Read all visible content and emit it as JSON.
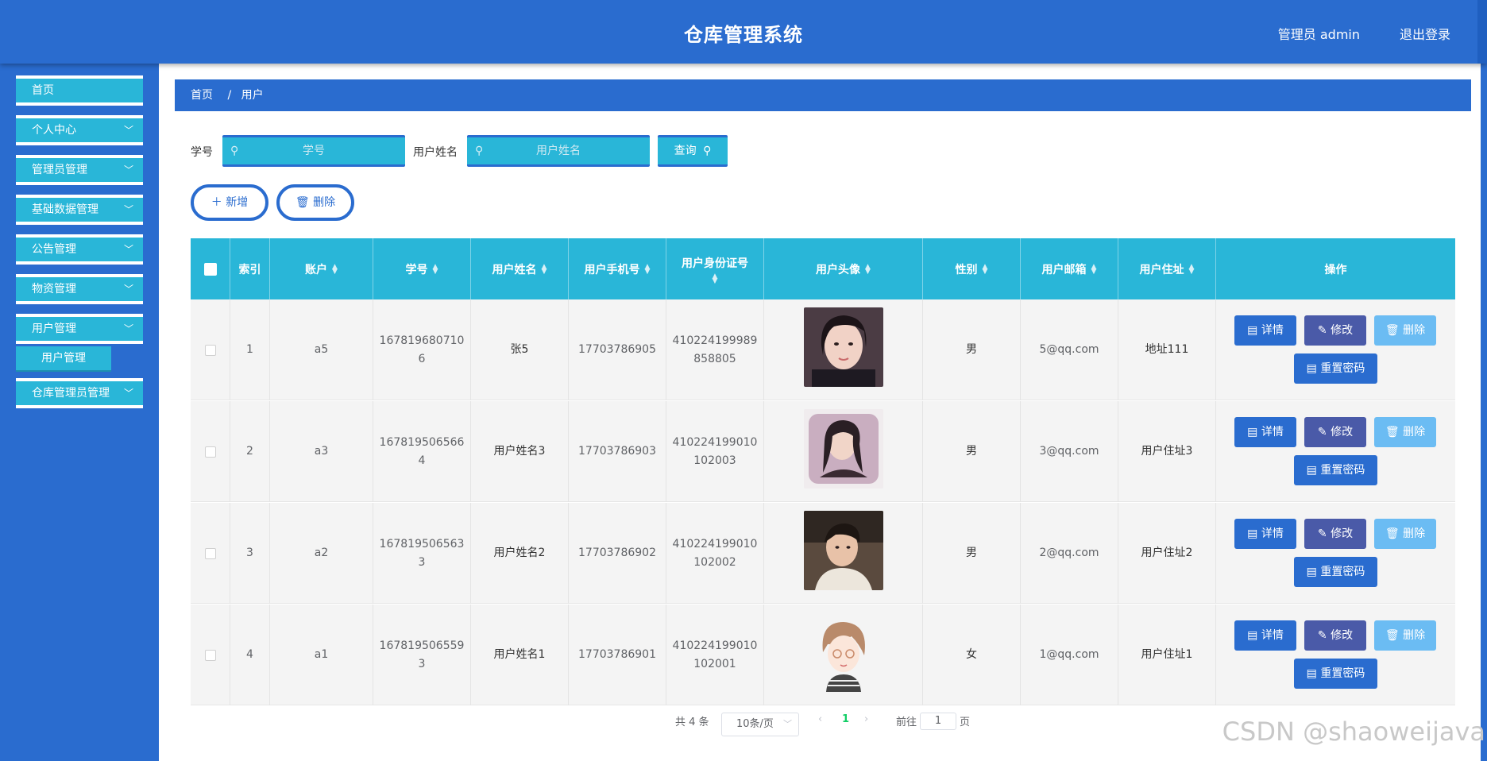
{
  "header": {
    "title": "仓库管理系统",
    "user": "管理员 admin",
    "logout": "退出登录"
  },
  "sidebar": {
    "items": [
      {
        "label": "首页",
        "chevron": false
      },
      {
        "label": "个人中心",
        "chevron": true
      },
      {
        "label": "管理员管理",
        "chevron": true
      },
      {
        "label": "基础数据管理",
        "chevron": true
      },
      {
        "label": "公告管理",
        "chevron": true
      },
      {
        "label": "物资管理",
        "chevron": true
      },
      {
        "label": "用户管理",
        "chevron": true
      },
      {
        "label": "仓库管理员管理",
        "chevron": true
      }
    ],
    "sub_item": "用户管理"
  },
  "breadcrumb": {
    "home": "首页",
    "sep": "/",
    "current": "用户"
  },
  "search": {
    "student_id_label": "学号",
    "student_id_placeholder": "学号",
    "name_label": "用户姓名",
    "name_placeholder": "用户姓名",
    "query_button": "查询"
  },
  "actions": {
    "add": "新增",
    "delete": "删除"
  },
  "table": {
    "columns": [
      "索引",
      "账户",
      "学号",
      "用户姓名",
      "用户手机号",
      "用户身份证号",
      "用户头像",
      "性别",
      "用户邮箱",
      "用户住址",
      "操作"
    ],
    "rows": [
      {
        "index": "1",
        "account": "a5",
        "student_id_1": "167819680710",
        "student_id_2": "6",
        "name": "张5",
        "phone": "17703786905",
        "idcard_1": "410224199989",
        "idcard_2": "858805",
        "avatar": "female-portrait",
        "gender": "男",
        "email": "5@qq.com",
        "address": "地址111"
      },
      {
        "index": "2",
        "account": "a3",
        "student_id_1": "167819506566",
        "student_id_2": "4",
        "name": "用户姓名3",
        "phone": "17703786903",
        "idcard_1": "410224199010",
        "idcard_2": "102003",
        "avatar": "pillow-portrait",
        "gender": "男",
        "email": "3@qq.com",
        "address": "用户住址3"
      },
      {
        "index": "3",
        "account": "a2",
        "student_id_1": "167819506563",
        "student_id_2": "3",
        "name": "用户姓名2",
        "phone": "17703786902",
        "idcard_1": "410224199010",
        "idcard_2": "102002",
        "avatar": "male-portrait",
        "gender": "男",
        "email": "2@qq.com",
        "address": "用户住址2"
      },
      {
        "index": "4",
        "account": "a1",
        "student_id_1": "167819506559",
        "student_id_2": "3",
        "name": "用户姓名1",
        "phone": "17703786901",
        "idcard_1": "410224199010",
        "idcard_2": "102001",
        "avatar": "cartoon-girl",
        "gender": "女",
        "email": "1@qq.com",
        "address": "用户住址1"
      }
    ],
    "ops": {
      "detail": "详情",
      "edit": "修改",
      "delete": "删除",
      "reset": "重置密码"
    }
  },
  "pagination": {
    "total": "共 4 条",
    "page_size": "10条/页",
    "prev": "‹",
    "page": "1",
    "next": "›",
    "goto_label": "前往",
    "goto_value": "1",
    "page_unit": "页"
  },
  "watermark": "CSDN @shaoweijava",
  "colors": {
    "primary": "#2a6ccf",
    "accent": "#29b6d8",
    "edit": "#4a5aa8",
    "delete": "#6bbcf3",
    "active_page": "#13ce66"
  }
}
